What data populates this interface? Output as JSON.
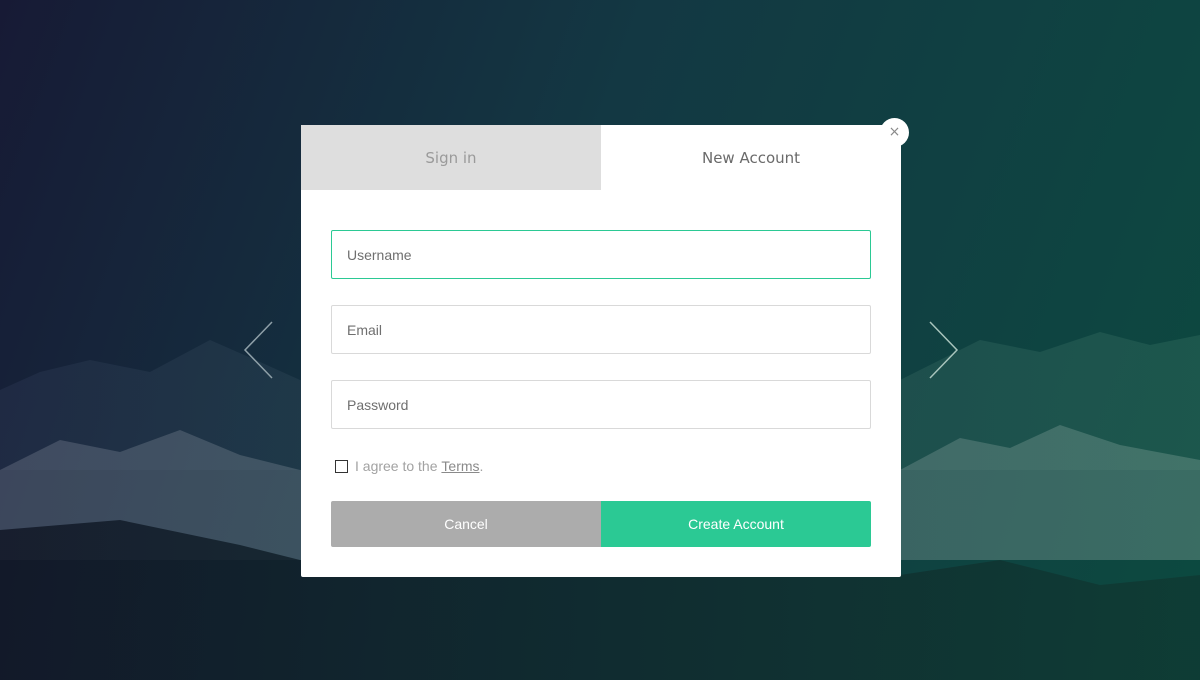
{
  "colors": {
    "accent": "#2bc994",
    "cancel": "#acacac",
    "inactive_tab": "#dedede"
  },
  "tabs": [
    {
      "label": "Sign in",
      "active": false
    },
    {
      "label": "New Account",
      "active": true
    }
  ],
  "close": {
    "icon": "close-icon",
    "glyph": "×"
  },
  "nav": {
    "prev_icon": "chevron-left-icon",
    "next_icon": "chevron-right-icon"
  },
  "form": {
    "username": {
      "placeholder": "Username",
      "value": ""
    },
    "email": {
      "placeholder": "Email",
      "value": ""
    },
    "password": {
      "placeholder": "Password",
      "value": ""
    },
    "agree": {
      "prefix": "I agree to the ",
      "link": "Terms",
      "suffix": ".",
      "checked": false
    },
    "cancel_label": "Cancel",
    "create_label": "Create Account"
  }
}
